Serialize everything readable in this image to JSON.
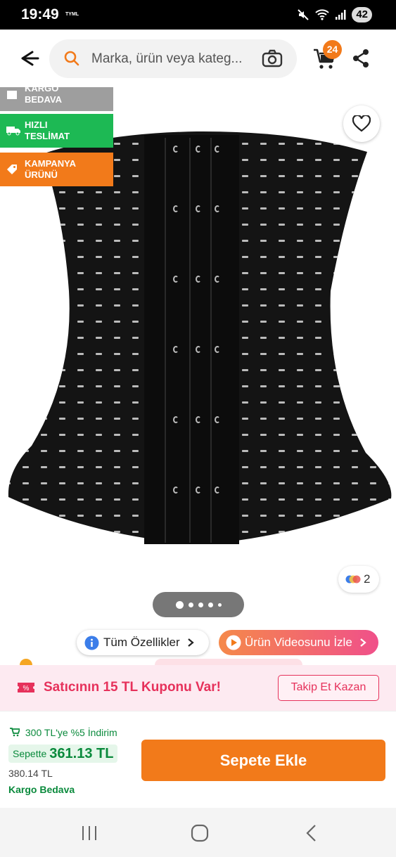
{
  "status_bar": {
    "time": "19:49",
    "carrier": "TYML",
    "battery": "42"
  },
  "header": {
    "search_placeholder": "Marka, ürün veya kateg...",
    "cart_count": "24"
  },
  "badges": [
    {
      "label": "KARGO BEDAVA",
      "color": "#9e9e9e"
    },
    {
      "label": "HIZLI TESLİMAT",
      "color": "#1db954"
    },
    {
      "label": "KAMPANYA ÜRÜNÜ",
      "color": "#f27a1a"
    }
  ],
  "gallery": {
    "color_count": "2",
    "image_count": 5,
    "active_index": 0
  },
  "actions": {
    "features_label": "Tüm Özellikler",
    "video_label": "Ürün Videosunu İzle"
  },
  "coupon": {
    "text": "Satıcının 15 TL Kuponu Var!",
    "button": "Takip Et Kazan"
  },
  "bottom": {
    "discount": "300 TL'ye %5 İndirim",
    "basket_label": "Sepette",
    "basket_price": "361.13 TL",
    "old_price": "380.14 TL",
    "free_shipping": "Kargo Bedava",
    "add_to_cart": "Sepete Ekle"
  },
  "colors": {
    "accent": "#f27a1a",
    "green": "#0a8a3c",
    "pink": "#e6315b"
  }
}
